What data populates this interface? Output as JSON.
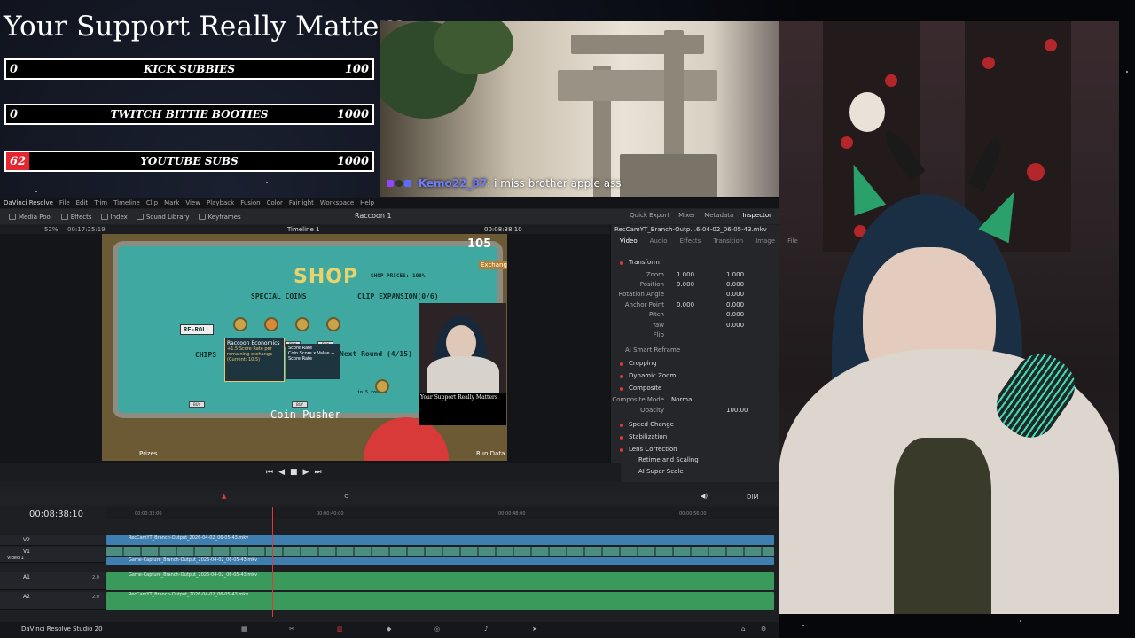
{
  "overlay": {
    "title": "Your Support Really Matters",
    "goals": [
      {
        "current": "0",
        "label": "KICK SUBBIES",
        "target": "100",
        "progress": 0
      },
      {
        "current": "0",
        "label": "TWITCH BITTIE BOOTIES",
        "target": "1000",
        "progress": 0
      },
      {
        "current": "62",
        "label": "YOUTUBE SUBS",
        "target": "1000",
        "progress": 0.062
      }
    ]
  },
  "chat": {
    "user": "Kemo22_87",
    "sep": ":",
    "message": "i miss brother apple ass"
  },
  "resolve": {
    "menu": [
      "DaVinci Resolve",
      "File",
      "Edit",
      "Trim",
      "Timeline",
      "Clip",
      "Mark",
      "View",
      "Playback",
      "Fusion",
      "Color",
      "Fairlight",
      "Workspace",
      "Help"
    ],
    "toolbar_left": [
      "Media Pool",
      "Effects",
      "Index",
      "Sound Library",
      "Keyframes"
    ],
    "project_name": "Raccoon 1",
    "toolbar_right": [
      "Quick Export",
      "Mixer",
      "Metadata",
      "Inspector"
    ],
    "viewer": {
      "zoom": "52%",
      "timecode_src": "00:17:25:19",
      "timeline_name": "Timeline 1",
      "timecode": "00:08:38:10",
      "clip_name": "RecCamYT_Branch-Outp...6-04-02_06-05-43.mkv"
    },
    "inspector_tabs": [
      "Video",
      "Audio",
      "Effects",
      "Transition",
      "Image",
      "File"
    ],
    "transform": {
      "label": "Transform",
      "params": [
        {
          "name": "Zoom",
          "x": "1.000",
          "y": "1.000"
        },
        {
          "name": "Position",
          "x": "9.000",
          "y": "0.000"
        },
        {
          "name": "Rotation Angle",
          "x": "0.000",
          "y": ""
        },
        {
          "name": "Anchor Point",
          "x": "0.000",
          "y": "0.000"
        },
        {
          "name": "Pitch",
          "x": "0.000",
          "y": ""
        },
        {
          "name": "Yaw",
          "x": "0.000",
          "y": ""
        },
        {
          "name": "Flip",
          "x": "",
          "y": ""
        }
      ]
    },
    "sections": [
      "AI Smart Reframe",
      "Cropping",
      "Dynamic Zoom",
      "Composite",
      "Speed Change",
      "Stabilization",
      "Lens Correction",
      "Retime and Scaling",
      "AI Super Scale"
    ],
    "composite": {
      "mode_label": "Composite Mode",
      "mode": "Normal",
      "opacity_label": "Opacity",
      "opacity": "100.00"
    },
    "timeline": {
      "timecode": "00:08:38:10",
      "ruler": [
        "00:00:32:00",
        "00:00:40:00",
        "00:00:48:00",
        "00:00:56:00"
      ],
      "tracks": [
        {
          "id": "V2",
          "name": "",
          "clip": "RecCamYT_Branch-Output_2026-04-02_06-05-43.mkv"
        },
        {
          "id": "V1",
          "name": "Video 1",
          "clip": "Game-Capture_Branch-Output_2026-04-02_06-05-43.mkv"
        },
        {
          "id": "A1",
          "name": "",
          "level": "2.0",
          "clip": "Game-Capture_Branch-Output_2026-04-02_06-05-43.mkv"
        },
        {
          "id": "A2",
          "name": "",
          "level": "2.0",
          "clip": "RecCamYT_Branch-Output_2026-04-02_06-05-43.mkv"
        }
      ]
    },
    "volume": "DIM",
    "app_footer": "DaVinci Resolve Studio 20"
  },
  "game": {
    "shop": "SHOP",
    "prices": "SHOP PRICES: 100%",
    "count": "105",
    "exchange": "Exchange",
    "special": "SPECIAL COINS",
    "clip": "CLIP EXPANSION(0/6)",
    "reroll": "RE-ROLL",
    "chips": "CHIPS",
    "next_round": "Next Round (4/15)",
    "in_rounds": "in 5 rounds",
    "tip_title": "Raccoon Economics",
    "tip_body": "+1.5 Score Rate per remaining exchange (Current: 10.5)",
    "formula": "Score Rate\nCoin Score x Value + Score Rate",
    "pusher": "Coin Pusher",
    "prizes": "Prizes",
    "run_data": "Run Data",
    "pip_title": "Your Support Really Matters"
  },
  "colors": {
    "accent_red": "#e3262f",
    "playhead": "#e0393a",
    "video_clip": "#3f7fb0",
    "audio_clip": "#3a9a5c",
    "chat_user": "#6f7cff"
  }
}
